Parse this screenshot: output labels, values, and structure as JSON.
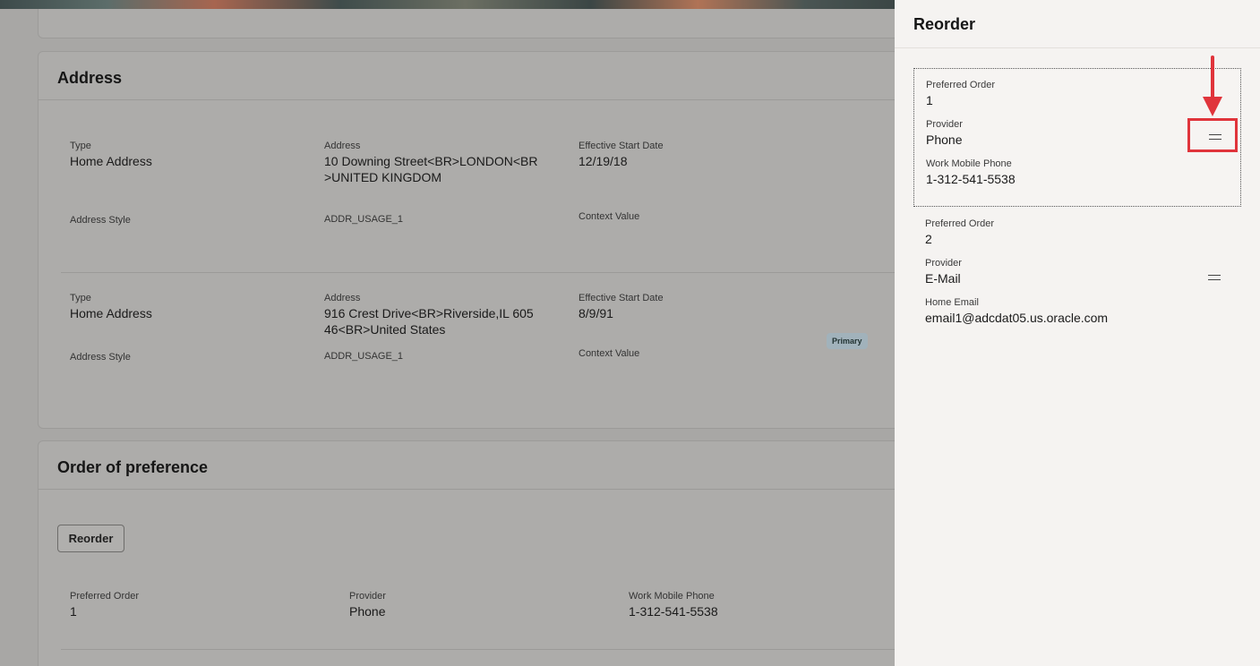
{
  "address": {
    "title": "Address",
    "rows": [
      {
        "type_label": "Type",
        "type_value": "Home Address",
        "address_label": "Address",
        "address_value": "10 Downing Street<BR>LONDON<BR>UNITED KINGDOM",
        "start_label": "Effective Start Date",
        "start_value": "12/19/18",
        "style_label": "Address Style",
        "style_value": "ADDR_USAGE_1",
        "context_label": "Context Value"
      },
      {
        "type_label": "Type",
        "type_value": "Home Address",
        "address_label": "Address",
        "address_value": "916 Crest Drive<BR>Riverside,IL 60546<BR>United States",
        "start_label": "Effective Start Date",
        "start_value": "8/9/91",
        "style_label": "Address Style",
        "style_value": "ADDR_USAGE_1",
        "context_label": "Context Value",
        "badge": "Primary"
      }
    ]
  },
  "order": {
    "title": "Order of preference",
    "reorder_button": "Reorder",
    "row": {
      "preferred_label": "Preferred Order",
      "preferred_value": "1",
      "provider_label": "Provider",
      "provider_value": "Phone",
      "contact_label": "Work Mobile Phone",
      "contact_value": "1-312-541-5538"
    }
  },
  "panel": {
    "title": "Reorder",
    "items": [
      {
        "preferred_label": "Preferred Order",
        "preferred_value": "1",
        "provider_label": "Provider",
        "provider_value": "Phone",
        "contact_label": "Work Mobile Phone",
        "contact_value": "1-312-541-5538",
        "handle_icon": "drag-handle-icon"
      },
      {
        "preferred_label": "Preferred Order",
        "preferred_value": "2",
        "provider_label": "Provider",
        "provider_value": "E-Mail",
        "contact_label": "Home Email",
        "contact_value": "email1@adcdat05.us.oracle.com",
        "handle_icon": "drag-handle-icon"
      }
    ]
  },
  "colors": {
    "annotation": "#e0343b",
    "panel_bg": "#f5f3f1",
    "overlay_bg": "#a8a7a5"
  }
}
